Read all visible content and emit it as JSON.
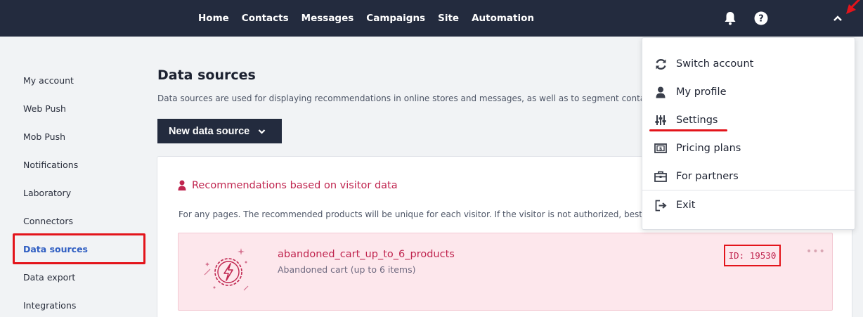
{
  "topbar": {
    "nav": [
      "Home",
      "Contacts",
      "Messages",
      "Campaigns",
      "Site",
      "Automation"
    ],
    "icons": [
      "bell-icon",
      "help-icon",
      "chevron-up-icon"
    ]
  },
  "sidebar": {
    "items": [
      {
        "label": "My account"
      },
      {
        "label": "Web Push"
      },
      {
        "label": "Mob Push"
      },
      {
        "label": "Notifications"
      },
      {
        "label": "Laboratory"
      },
      {
        "label": "Connectors"
      },
      {
        "label": "Data sources",
        "active": true
      },
      {
        "label": "Data export"
      },
      {
        "label": "Integrations"
      }
    ]
  },
  "main": {
    "title": "Data sources",
    "description": "Data sources are used for displaying recommendations in online stores and messages, as well as to segment contacts b",
    "new_button": "New data source"
  },
  "card": {
    "title": "Recommendations based on visitor data",
    "description": "For any pages. The recommended products will be unique for each visitor. If the visitor is not authorized, bestselle",
    "source": {
      "name": "abandoned_cart_up_to_6_products",
      "subtitle": "Abandoned cart (up to 6 items)",
      "id": "ID: 19530",
      "menu": "•••"
    }
  },
  "dropdown": {
    "items": [
      {
        "label": "Switch account",
        "icon": "switch-account-icon"
      },
      {
        "label": "My profile",
        "icon": "person-icon"
      },
      {
        "label": "Settings",
        "icon": "sliders-icon"
      },
      {
        "label": "Pricing plans",
        "icon": "pricing-icon"
      },
      {
        "label": "For partners",
        "icon": "briefcase-icon"
      },
      {
        "label": "Exit",
        "icon": "exit-icon"
      }
    ]
  },
  "colors": {
    "topbar": "#232b3e",
    "accent_red": "#e3141b",
    "brand_pink": "#c0254f",
    "active_blue": "#2f5ec2",
    "row_bg": "#fde7ec"
  }
}
